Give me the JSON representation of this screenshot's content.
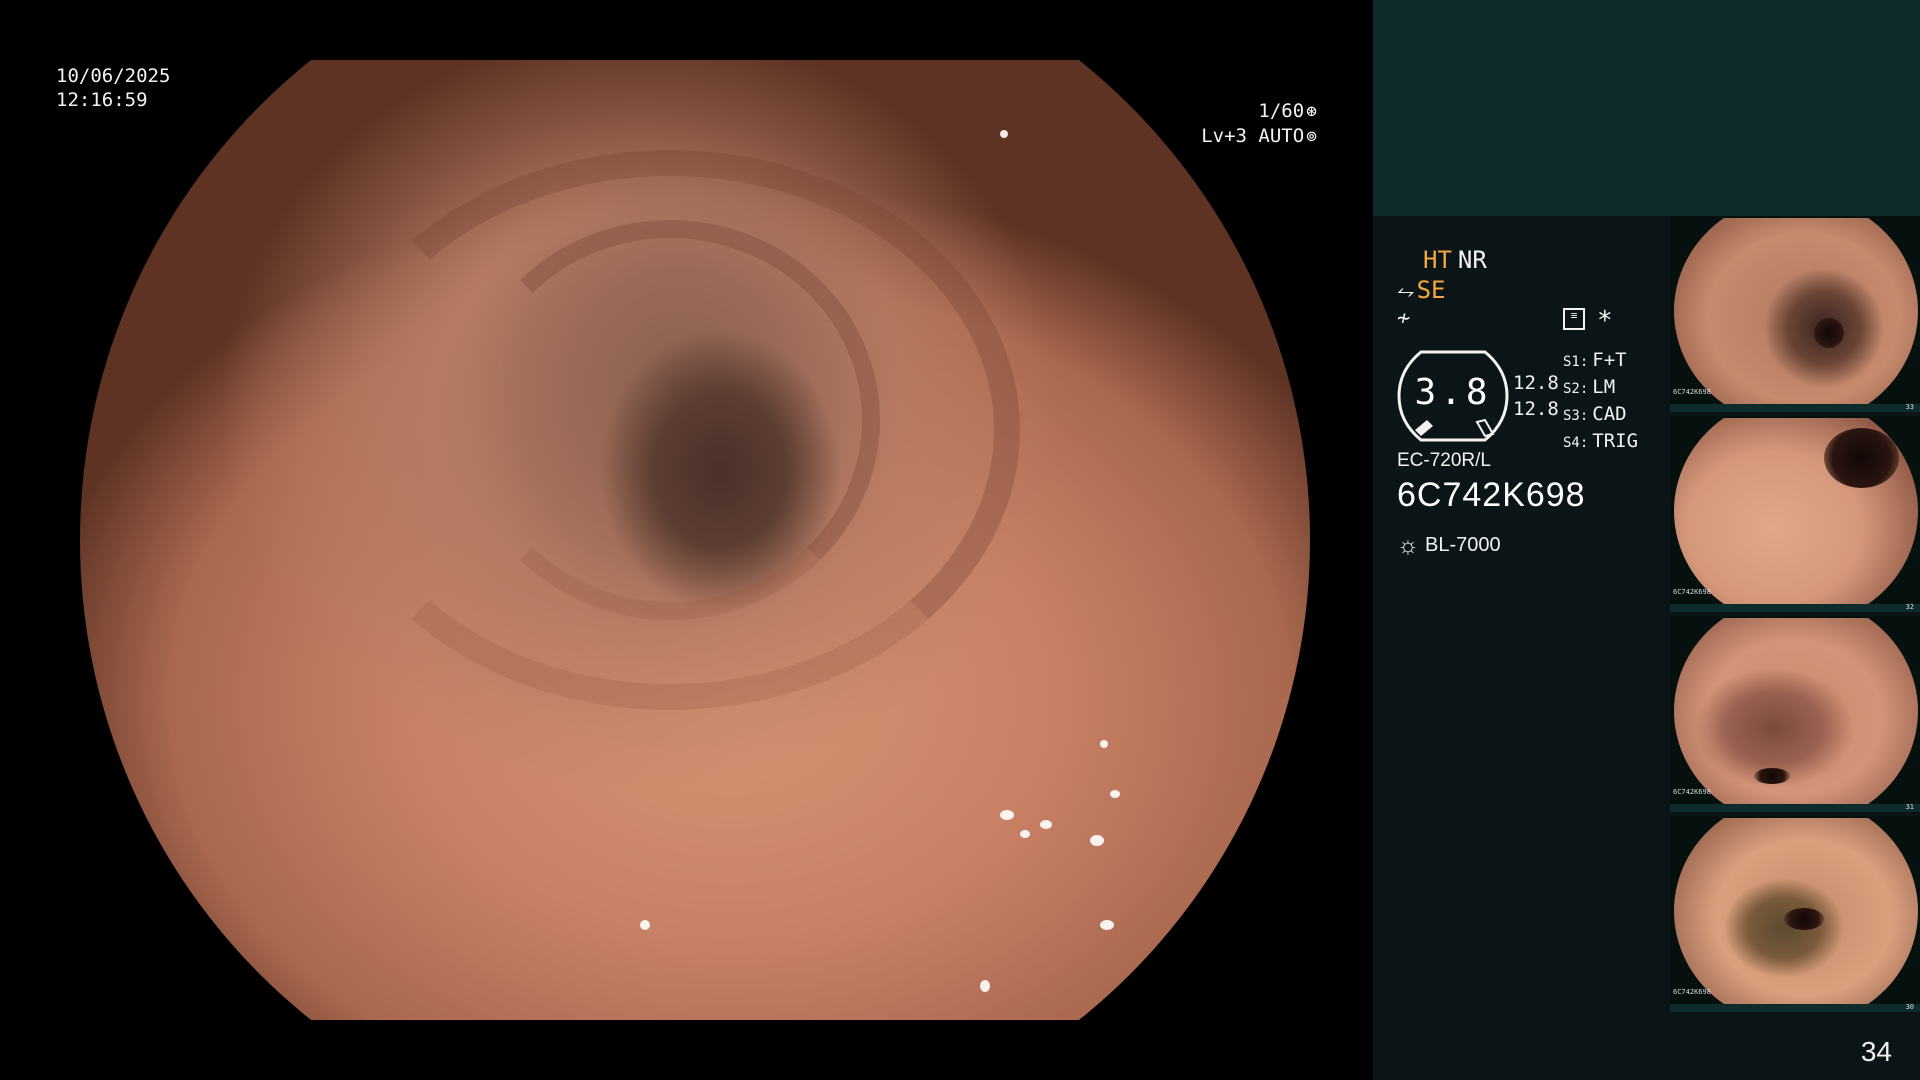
{
  "osd": {
    "date": "10/06/2025",
    "time": "12:16:59",
    "shutter": "1/60",
    "level_mode": "Lv+3 AUTO"
  },
  "panel": {
    "mode_ht": "HT",
    "mode_nr": "NR",
    "mode_se": "SE",
    "gauge_value": "3.8",
    "gauge_sub_1": "12.8",
    "gauge_sub_2": "12.8",
    "switches": [
      {
        "key": "S1:",
        "label": "F+T"
      },
      {
        "key": "S2:",
        "label": "LM"
      },
      {
        "key": "S3:",
        "label": "CAD"
      },
      {
        "key": "S4:",
        "label": "TRIG"
      }
    ],
    "scope_model": "EC-720R/L",
    "scope_serial": "6C742K698",
    "light_source": "BL-7000",
    "asterisk": "*"
  },
  "thumbnails": [
    {
      "serial": "6C742K698",
      "num": "33"
    },
    {
      "serial": "6C742K698",
      "num": "32"
    },
    {
      "serial": "6C742K698",
      "num": "31"
    },
    {
      "serial": "6C742K698",
      "num": "30"
    }
  ],
  "page_number": "34",
  "colors": {
    "accent_orange": "#f5a742",
    "panel_top": "#0e2a2b",
    "panel_bg": "#0b1517"
  },
  "icons": {
    "shutter": "aperture-icon",
    "auto": "iris-icon",
    "enhance": "enhance-icon",
    "freeze": "freeze-icon",
    "menu": "menu-icon",
    "light": "lamp-icon"
  }
}
